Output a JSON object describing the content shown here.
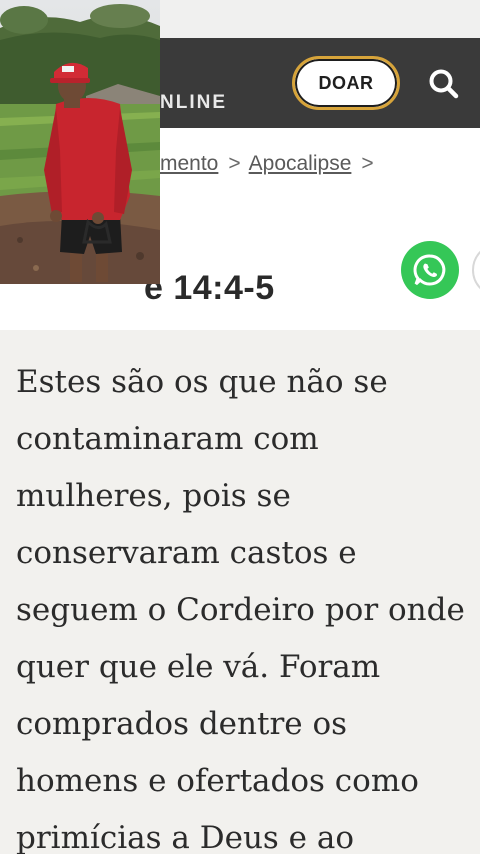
{
  "header": {
    "brand_suffix": "NLINE",
    "donate_label": "DOAR",
    "search_icon": "search-icon",
    "background_color": "#3a3a3a",
    "accent_color": "#d7a43a"
  },
  "breadcrumb": {
    "testament": "mento",
    "separator": ">",
    "book": "Apocalipse",
    "trailing_separator": ">"
  },
  "verse": {
    "title": "Apocalipse 14:4-5",
    "visible_title": "e 14:4-5",
    "text": "Estes são os que não se\ncontaminaram com\nmulheres, pois se\nconservaram castos e\nseguem o Cordeiro por onde\nquer que ele vá. Foram\ncomprados dentre os\nhomens e ofertados como\nprimícias a Deus e ao"
  },
  "share": {
    "whatsapp_icon": "whatsapp-icon",
    "whatsapp_color": "#35c757"
  },
  "video_overlay": {
    "content": "man-in-red-cap-farm-field"
  }
}
